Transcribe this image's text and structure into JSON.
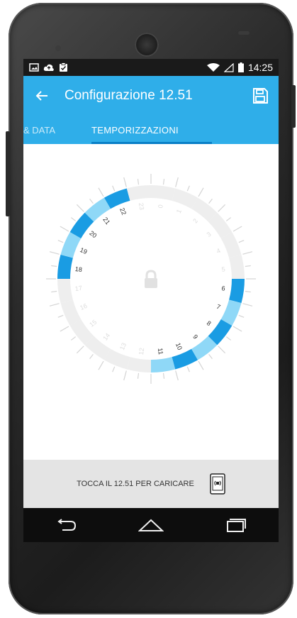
{
  "status_bar": {
    "time": "14:25",
    "left_icons": [
      "image-icon",
      "cloud-upload-icon",
      "clipboard-check-icon"
    ],
    "right_icons": [
      "wifi-icon",
      "signal-icon",
      "battery-icon"
    ]
  },
  "app_bar": {
    "title": "Configurazione 12.51",
    "back_icon": "arrow-left-icon",
    "action_icon": "save-icon"
  },
  "tabs": {
    "previous": "& DATA",
    "active": "TEMPORIZZAZIONI"
  },
  "dial": {
    "center_icon": "lock-icon",
    "hours": [
      "0",
      "1",
      "2",
      "3",
      "4",
      "5",
      "6",
      "7",
      "8",
      "9",
      "10",
      "11",
      "12",
      "13",
      "14",
      "15",
      "16",
      "17",
      "18",
      "19",
      "20",
      "21",
      "22",
      "23"
    ],
    "active_hours": [
      6,
      7,
      8,
      9,
      10,
      11,
      18,
      19,
      20,
      21,
      22
    ],
    "colors": {
      "active_dark": "#1a9ce3",
      "active_light": "#8fd8f7",
      "inactive": "#eeeeee",
      "tick": "#d4d4d4"
    }
  },
  "action_bar": {
    "label": "TOCCA IL 12.51 PER CARICARE",
    "icon": "nfc-phone-icon"
  },
  "nav_bar": {
    "icons": [
      "back-nav-icon",
      "home-nav-icon",
      "recents-nav-icon"
    ]
  }
}
